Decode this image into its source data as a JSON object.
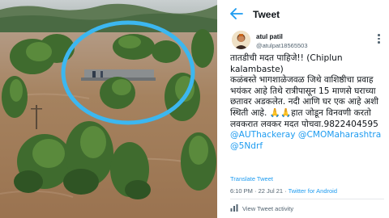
{
  "header": {
    "title": "Tweet"
  },
  "user": {
    "name": "atul patil",
    "handle": "@atulpat18565503"
  },
  "tweet": {
    "lines": [
      "तातडीची मदत पाहिजे!! (Chiplun",
      "kalambaste)",
      "कळंबस्ते भागशाळेजवळ जिथे वाशिष्ठीचा प्रवाह",
      "भयंकर आहे तिथे रात्रीपासून 15 माणसे घराच्या",
      "छतावर अडकलेत. नदी आणि घर एक आहे अशी",
      "स्थिती आहे. 🙏🙏हात जोडून विनवणी करतो",
      "लवकरात लवकर मदत पोचवा.9822404595"
    ],
    "mentions_line1": "@AUThackeray @CMOMaharashtra",
    "mentions_line2": "@5Ndrf"
  },
  "translate_label": "Translate Tweet",
  "meta": {
    "time": "6:10 PM · 22 Jul 21 · ",
    "source": "Twitter for Android"
  },
  "activity_label": "View Tweet activity",
  "colors": {
    "link": "#1d9bf0",
    "flood_water": "#a4805d",
    "highlight_circle": "#3cb7f0"
  }
}
